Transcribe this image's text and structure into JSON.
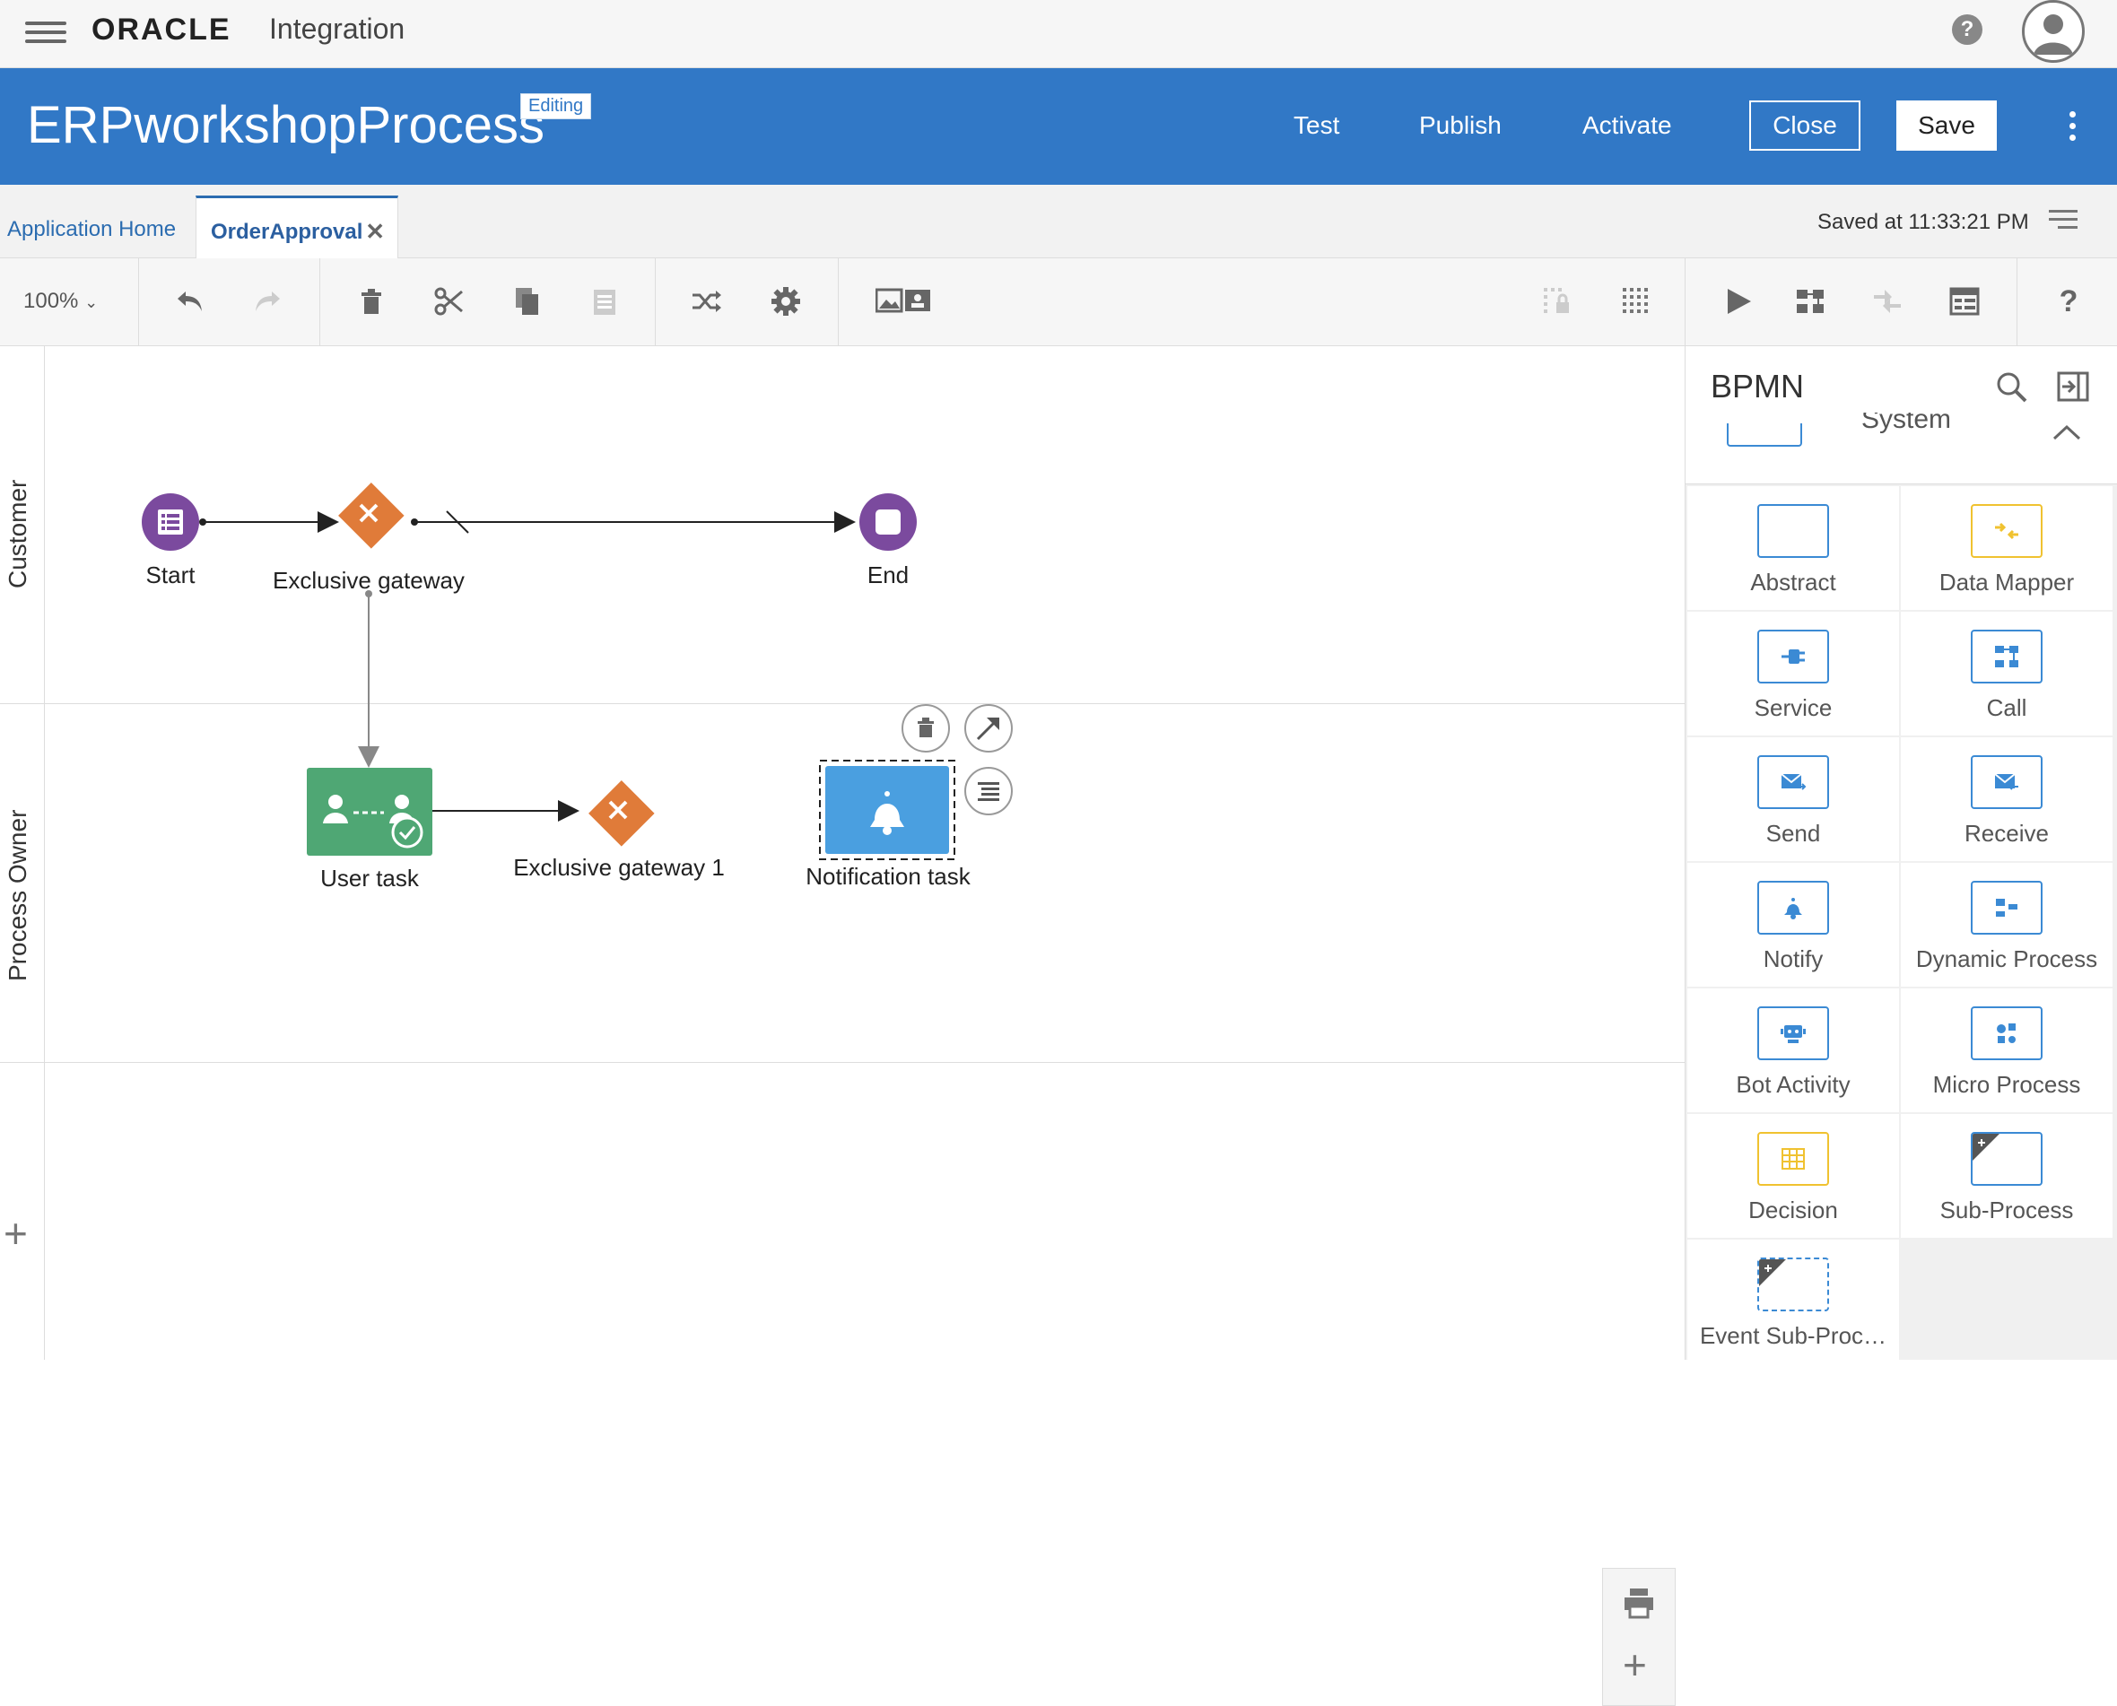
{
  "topbar": {
    "brand": "ORACLE",
    "product": "Integration",
    "help_icon": "question-circle-icon",
    "avatar_icon": "user-avatar-icon",
    "menu_icon": "hamburger-menu-icon"
  },
  "header": {
    "title": "ERPworkshopProcess",
    "badge": "Editing",
    "actions": {
      "test": "Test",
      "publish": "Publish",
      "activate": "Activate",
      "close": "Close",
      "save": "Save"
    },
    "more_icon": "kebab-menu-icon",
    "color": "#3178c6"
  },
  "tabs": {
    "home": "Application Home",
    "active": "OrderApproval",
    "close_glyph": "✕",
    "saved_at": "Saved at 11:33:21 PM",
    "menu_icon": "list-menu-icon"
  },
  "toolbar": {
    "zoom": "100%",
    "icons": [
      "undo-icon",
      "redo-icon",
      "delete-icon",
      "cut-icon",
      "copy-icon",
      "paste-icon",
      "shuffle-icon",
      "settings-gear-icon",
      "image-card-icon",
      "lock-grid-icon",
      "grid-dots-icon",
      "play-icon",
      "flow-icon",
      "collapse-arrows-icon",
      "form-table-icon",
      "help-question-icon"
    ]
  },
  "canvas": {
    "lanes": [
      "Customer",
      "Process Owner"
    ],
    "nodes": {
      "start": "Start",
      "gateway": "Exclusive gateway",
      "end": "End",
      "user_task": "User task",
      "gateway1": "Exclusive gateway 1",
      "notification": "Notification task"
    },
    "colors": {
      "event": "#7b4a9e",
      "gateway": "#e07b39",
      "user_task": "#4fa774",
      "notification": "#4a9fe0"
    },
    "add_lane": "+",
    "zoom_plus": "+"
  },
  "palette": {
    "title": "BPMN",
    "section_partial": "System",
    "items": [
      {
        "label": "Abstract",
        "icon": "abstract-box-icon"
      },
      {
        "label": "Data Mapper",
        "icon": "data-mapper-icon"
      },
      {
        "label": "Service",
        "icon": "service-plug-icon"
      },
      {
        "label": "Call",
        "icon": "call-flow-icon"
      },
      {
        "label": "Send",
        "icon": "send-envelope-icon"
      },
      {
        "label": "Receive",
        "icon": "receive-envelope-icon"
      },
      {
        "label": "Notify",
        "icon": "bell-icon"
      },
      {
        "label": "Dynamic Process",
        "icon": "dynamic-process-icon"
      },
      {
        "label": "Bot Activity",
        "icon": "bot-icon"
      },
      {
        "label": "Micro Process",
        "icon": "micro-process-icon"
      },
      {
        "label": "Decision",
        "icon": "decision-table-icon"
      },
      {
        "label": "Sub-Process",
        "icon": "sub-process-icon"
      },
      {
        "label": "Event Sub-Proc…",
        "icon": "event-sub-process-icon"
      }
    ]
  }
}
